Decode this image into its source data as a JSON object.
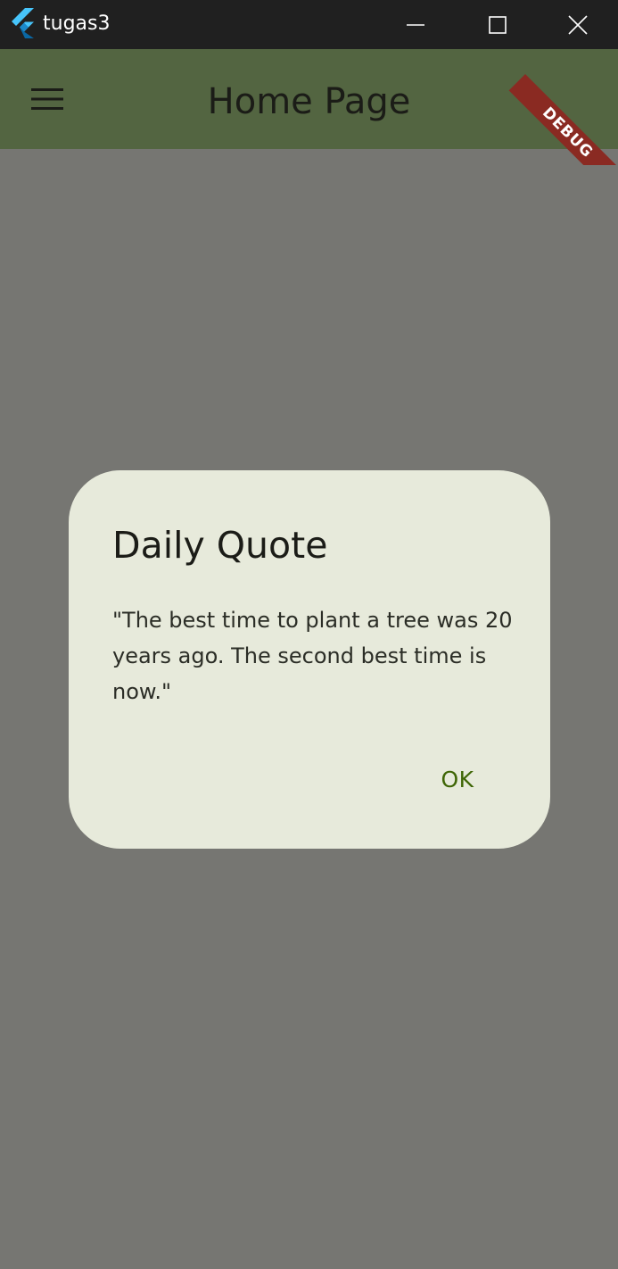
{
  "window": {
    "title": "tugas3",
    "controls": {
      "minimize_icon": "minimize-icon",
      "maximize_icon": "maximize-icon",
      "close_icon": "close-icon"
    }
  },
  "appbar": {
    "title": "Home Page",
    "menu_icon": "hamburger-menu-icon",
    "debug_banner": "DEBUG",
    "color": "#536541"
  },
  "dialog": {
    "title": "Daily Quote",
    "body": "\"The best time to plant a tree was 20 years ago. The second best time is now.\"",
    "ok_label": "OK",
    "background": "#e7eadb",
    "accent": "#3f6606"
  },
  "scrim_color": "#767672"
}
